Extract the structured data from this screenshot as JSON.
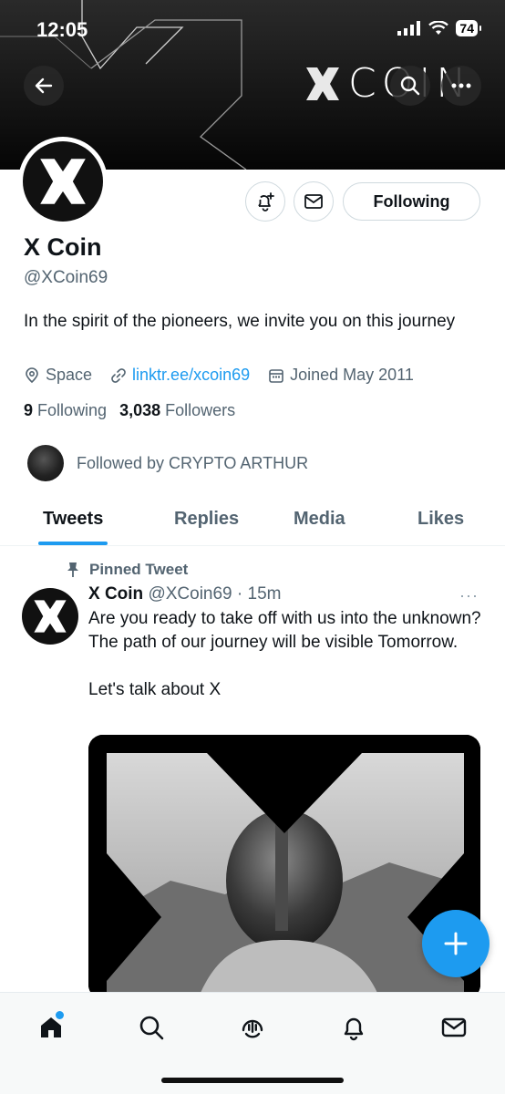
{
  "status_bar": {
    "time": "12:05",
    "battery": "74"
  },
  "banner": {
    "brand_text": "COIN"
  },
  "profile": {
    "name": "X Coin",
    "handle": "@XCoin69",
    "following_button": "Following",
    "bio": "In the spirit of the pioneers, we invite you on this journey",
    "location": "Space",
    "link": "linktr.ee/xcoin69",
    "joined": "Joined May 2011",
    "following_count": "9",
    "following_label": "Following",
    "followers_count": "3,038",
    "followers_label": "Followers",
    "followed_by": "Followed by CRYPTO ARTHUR"
  },
  "tabs": [
    {
      "label": "Tweets",
      "active": true
    },
    {
      "label": "Replies",
      "active": false
    },
    {
      "label": "Media",
      "active": false
    },
    {
      "label": "Likes",
      "active": false
    }
  ],
  "tweet": {
    "pinned_label": "Pinned Tweet",
    "author": "X Coin",
    "handle_time": "@XCoin69 · 15m",
    "more": "···",
    "text": "Are you ready to take off with us into the unknown? The path of our journey will be visible Tomorrow.\n\nLet's talk about X"
  },
  "colors": {
    "accent": "#1d9bf0",
    "text_primary": "#0f1419",
    "text_secondary": "#536471"
  },
  "icons": [
    "back-arrow-icon",
    "search-icon",
    "more-icon",
    "notification-plus-icon",
    "mail-icon",
    "location-icon",
    "link-icon",
    "calendar-icon",
    "pin-icon",
    "compose-plus-icon",
    "home-icon",
    "spaces-icon",
    "bell-icon"
  ]
}
